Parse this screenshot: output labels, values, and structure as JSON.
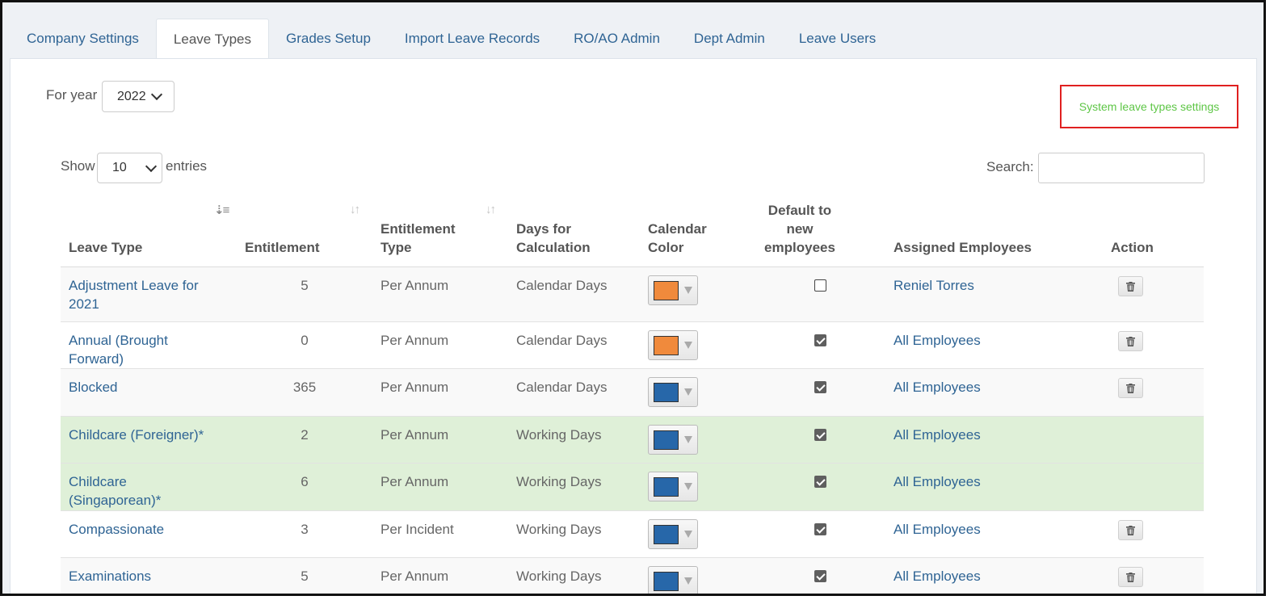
{
  "tabs": [
    {
      "label": "Company Settings",
      "active": false
    },
    {
      "label": "Leave Types",
      "active": true
    },
    {
      "label": "Grades Setup",
      "active": false
    },
    {
      "label": "Import Leave Records",
      "active": false
    },
    {
      "label": "RO/AO Admin",
      "active": false
    },
    {
      "label": "Dept Admin",
      "active": false
    },
    {
      "label": "Leave Users",
      "active": false
    }
  ],
  "year": {
    "label": "For year",
    "value": "2022"
  },
  "system_link": "System leave types settings",
  "length": {
    "show_label": "Show",
    "value": "10",
    "entries_label": "entries"
  },
  "search": {
    "label": "Search:",
    "value": ""
  },
  "columns": {
    "leave_type": "Leave Type",
    "entitlement": "Entitlement",
    "entitlement_type": "Entitlement Type",
    "days_for_calc": "Days for Calculation",
    "calendar_color": "Calendar Color",
    "default_new": "Default to new employees",
    "assigned": "Assigned Employees",
    "action": "Action"
  },
  "icons": {
    "sort_asc": "sort-amount-asc-icon",
    "sort_both": "sort-both-icon",
    "delete": "trash-icon",
    "dropdown": "chevron-down-icon"
  },
  "colors": {
    "orange": "#f08a3c",
    "blue": "#2767a9",
    "link": "#2f6494",
    "system_row": "#dff0d8",
    "system_link": "#5ec646",
    "highlight_box": "#e02020"
  },
  "rows": [
    {
      "leave_type": "Adjustment Leave for 2021",
      "entitlement": "5",
      "entitlement_type": "Per Annum",
      "days_for_calc": "Calendar Days",
      "color": "#f08a3c",
      "default_new": false,
      "assigned": "Reniel Torres",
      "deletable": true,
      "system": false
    },
    {
      "leave_type": "Annual (Brought Forward)",
      "entitlement": "0",
      "entitlement_type": "Per Annum",
      "days_for_calc": "Calendar Days",
      "color": "#f08a3c",
      "default_new": true,
      "assigned": "All Employees",
      "deletable": true,
      "system": false
    },
    {
      "leave_type": "Blocked",
      "entitlement": "365",
      "entitlement_type": "Per Annum",
      "days_for_calc": "Calendar Days",
      "color": "#2767a9",
      "default_new": true,
      "assigned": "All Employees",
      "deletable": true,
      "system": false
    },
    {
      "leave_type": "Childcare (Foreigner)*",
      "entitlement": "2",
      "entitlement_type": "Per Annum",
      "days_for_calc": "Working Days",
      "color": "#2767a9",
      "default_new": true,
      "assigned": "All Employees",
      "deletable": false,
      "system": true
    },
    {
      "leave_type": "Childcare (Singaporean)*",
      "entitlement": "6",
      "entitlement_type": "Per Annum",
      "days_for_calc": "Working Days",
      "color": "#2767a9",
      "default_new": true,
      "assigned": "All Employees",
      "deletable": false,
      "system": true
    },
    {
      "leave_type": "Compassionate",
      "entitlement": "3",
      "entitlement_type": "Per Incident",
      "days_for_calc": "Working Days",
      "color": "#2767a9",
      "default_new": true,
      "assigned": "All Employees",
      "deletable": true,
      "system": false
    },
    {
      "leave_type": "Examinations",
      "entitlement": "5",
      "entitlement_type": "Per Annum",
      "days_for_calc": "Working Days",
      "color": "#2767a9",
      "default_new": true,
      "assigned": "All Employees",
      "deletable": true,
      "system": false
    }
  ]
}
